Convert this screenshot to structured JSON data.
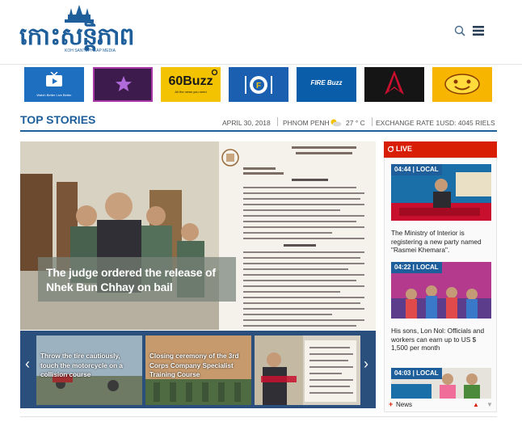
{
  "header": {
    "logo_text": "កោះសន្តិភាព",
    "logo_sub": "KOH SANTEPHEAP MEDIA"
  },
  "apps": [
    {
      "name": "tv",
      "caption": "Watch Better Live Better"
    },
    {
      "name": "star",
      "caption": ""
    },
    {
      "name": "60buzz",
      "label": "60Buzz",
      "caption": "All the news you need"
    },
    {
      "name": "food",
      "caption": ""
    },
    {
      "name": "firebuzz",
      "label": "FIRE Buzz",
      "caption": ""
    },
    {
      "name": "movie",
      "caption": ""
    },
    {
      "name": "funny",
      "caption": ""
    }
  ],
  "top_stories": {
    "title": "TOP STORIES",
    "date": "APRIL 30, 2018",
    "city": "PHNOM PENH",
    "temperature": "27 ° C",
    "exchange_rate": "EXCHANGE RATE 1USD: 4045 RIELS"
  },
  "hero": {
    "headline": "The judge ordered the release of Nhek Bun Chhay on bail"
  },
  "carousel": [
    {
      "text": "Throw the tire cautiously, touch the motorcycle on a collision course"
    },
    {
      "text": "Closing ceremony of the 3rd Corps Company Specialist Training Course"
    },
    {
      "text": ""
    }
  ],
  "live": {
    "label": "LIVE",
    "items": [
      {
        "time": "04:44 | LOCAL",
        "text": "The Ministry of Interior is registering a new party named \"Rasmei Khemara\"."
      },
      {
        "time": "04:22 | LOCAL",
        "text": "His sons, Lon Nol: Officials and workers can earn up to US $ 1,500 per month"
      },
      {
        "time": "04:03 | LOCAL",
        "text": ""
      }
    ],
    "news_link": "News"
  },
  "colors": {
    "brand": "#1e5f9b",
    "live_red": "#d81e05"
  }
}
